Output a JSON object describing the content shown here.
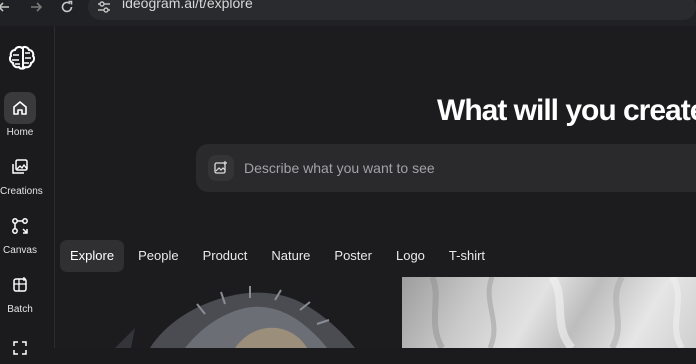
{
  "browser": {
    "url": "ideogram.ai/t/explore",
    "back_icon": "arrow-left-icon",
    "forward_icon": "arrow-right-icon",
    "reload_icon": "reload-icon"
  },
  "sidebar": {
    "logo_icon": "ideogram-logo-icon",
    "items": [
      {
        "label": "Home",
        "icon": "home-icon",
        "active": true
      },
      {
        "label": "Creations",
        "icon": "image-gallery-icon",
        "active": false
      },
      {
        "label": "Canvas",
        "icon": "canvas-icon",
        "active": false
      },
      {
        "label": "Batch",
        "icon": "batch-icon",
        "active": false
      }
    ]
  },
  "main": {
    "headline": "What will you create?",
    "prompt": {
      "placeholder": "Describe what you want to see",
      "icon": "add-image-icon"
    },
    "tabs": [
      {
        "label": "Explore",
        "active": true
      },
      {
        "label": "People",
        "active": false
      },
      {
        "label": "Product",
        "active": false
      },
      {
        "label": "Nature",
        "active": false
      },
      {
        "label": "Poster",
        "active": false
      },
      {
        "label": "Logo",
        "active": false
      },
      {
        "label": "T-shirt",
        "active": false
      }
    ]
  },
  "colors": {
    "background": "#1b1b1d",
    "active_tab": "#303033",
    "text": "#ffffff"
  }
}
